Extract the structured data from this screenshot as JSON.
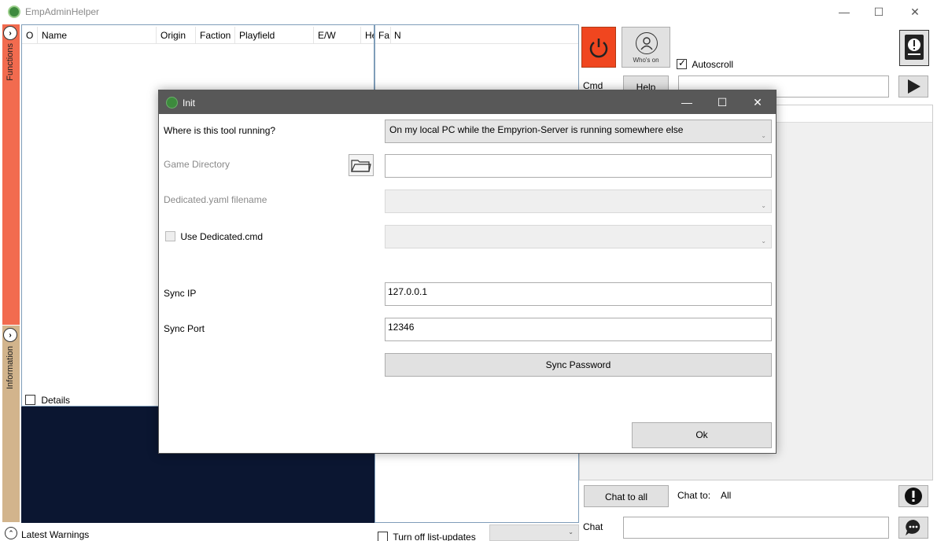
{
  "app": {
    "title": "EmpAdminHelper",
    "window_controls": {
      "minimize": "—",
      "maximize": "☐",
      "close": "✕"
    }
  },
  "sidebar": {
    "functions_label": "Functions",
    "information_label": "Information"
  },
  "player_grid": {
    "columns": [
      "O",
      "Name",
      "Origin",
      "Faction",
      "Playfield",
      "E/W",
      "He"
    ],
    "details_label": "Details"
  },
  "secondary_grid": {
    "columns": [
      "Fa",
      "N"
    ]
  },
  "toolbar": {
    "whos_on_label": "Who's on",
    "autoscroll_label": "Autoscroll",
    "autoscroll_checked": true,
    "cmd_label": "Cmd",
    "help_label": "Help"
  },
  "chat": {
    "chat_to_all_label": "Chat to all",
    "chat_to_label": "Chat to:",
    "chat_to_value": "All",
    "chat_label": "Chat"
  },
  "bottom": {
    "latest_warnings_label": "Latest Warnings",
    "turn_off_label": "Turn off list-updates"
  },
  "dialog": {
    "title": "Init",
    "where_running_label": "Where is this tool running?",
    "where_running_value": "On my local PC while the Empyrion-Server is running somewhere else",
    "game_directory_label": "Game Directory",
    "game_directory_value": "",
    "yaml_label": "Dedicated.yaml filename",
    "use_cmd_label": "Use Dedicated.cmd",
    "sync_ip_label": "Sync IP",
    "sync_ip_value": "127.0.0.1",
    "sync_port_label": "Sync Port",
    "sync_port_value": "12346",
    "sync_password_label": "Sync Password",
    "ok_label": "Ok"
  },
  "colors": {
    "functions_strip": "#f26b4f",
    "information_strip": "#d2b48c",
    "power_button": "#f0461f",
    "console_background": "#0b1631",
    "dialog_titlebar": "#585858"
  },
  "icons": [
    "app-icon",
    "power-icon",
    "whos-on-icon",
    "warning-icon",
    "send-icon",
    "folder-icon",
    "chat-bubble-icon",
    "chevron-icon"
  ]
}
